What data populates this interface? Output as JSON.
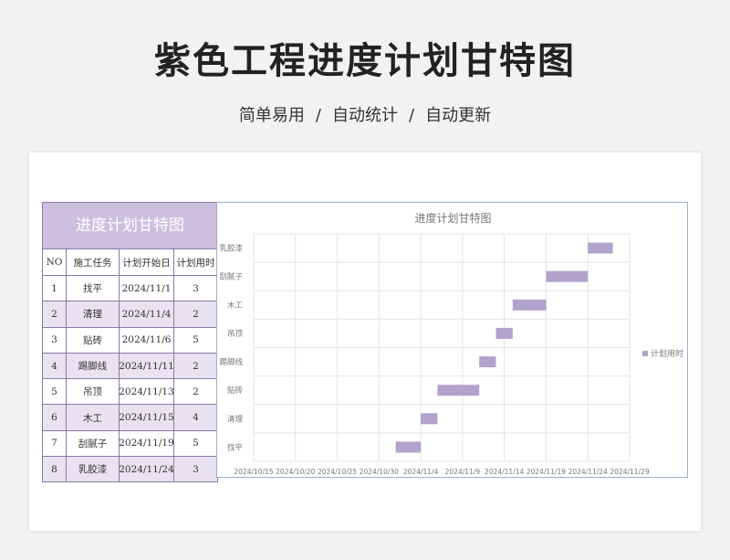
{
  "page": {
    "title": "紫色工程进度计划甘特图",
    "subtitle_items": [
      "简单易用",
      "自动统计",
      "自动更新"
    ],
    "separator": "/"
  },
  "table": {
    "title": "进度计划甘特图",
    "headers": [
      "NO",
      "施工任务",
      "计划开始日",
      "计划用时"
    ],
    "rows": [
      [
        "1",
        "找平",
        "2024/11/1",
        "3"
      ],
      [
        "2",
        "清理",
        "2024/11/4",
        "2"
      ],
      [
        "3",
        "贴砖",
        "2024/11/6",
        "5"
      ],
      [
        "4",
        "踢脚线",
        "2024/11/11",
        "2"
      ],
      [
        "5",
        "吊顶",
        "2024/11/13",
        "2"
      ],
      [
        "6",
        "木工",
        "2024/11/15",
        "4"
      ],
      [
        "7",
        "刮腻子",
        "2024/11/19",
        "5"
      ],
      [
        "8",
        "乳胶漆",
        "2024/11/24",
        "3"
      ]
    ]
  },
  "colors": {
    "bar": "#b3a2cc",
    "header_bg": "#cdbfdf",
    "alt_row": "#e9e2f0",
    "border": "#8a78a8"
  },
  "chart_data": {
    "type": "bar",
    "orientation": "horizontal-gantt",
    "title": "进度计划甘特图",
    "categories": [
      "找平",
      "清理",
      "贴砖",
      "踢脚线",
      "吊顶",
      "木工",
      "刮腻子",
      "乳胶漆"
    ],
    "start": [
      "2024/11/1",
      "2024/11/4",
      "2024/11/6",
      "2024/11/11",
      "2024/11/13",
      "2024/11/15",
      "2024/11/19",
      "2024/11/24"
    ],
    "series": [
      {
        "name": "计划用时",
        "values": [
          3,
          2,
          5,
          2,
          2,
          4,
          5,
          3
        ]
      }
    ],
    "x_ticks": [
      "2024/10/15",
      "2024/10/20",
      "2024/10/25",
      "2024/10/30",
      "2024/11/4",
      "2024/11/9",
      "2024/11/14",
      "2024/11/19",
      "2024/11/24",
      "2024/11/29"
    ],
    "xlim": [
      "2024/10/15",
      "2024/11/29"
    ],
    "grid": true,
    "legend_position": "right"
  }
}
